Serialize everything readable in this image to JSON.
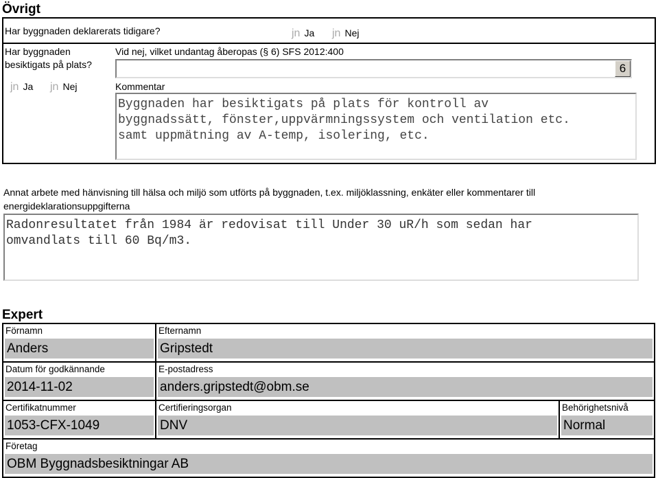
{
  "ovrigt": {
    "title": "Övrigt",
    "declared_question": "Har byggnaden deklarerats tidigare?",
    "radio_glyph": "jn",
    "yes": "Ja",
    "no": "Nej",
    "inspected_question_line1": "Har byggnaden",
    "inspected_question_line2": "besiktigats på plats?",
    "exception_label": "Vid nej, vilket undantag åberopas (§ 6) SFS 2012:400",
    "exception_value": "",
    "dropdown_glyph": "6",
    "comment_label": "Kommentar",
    "comment_value": "Byggnaden har besiktigats på plats för kontroll av\nbyggnadssätt, fönster,uppvärmningssystem och ventilation etc.\nsamt uppmätning av A-temp, isolering, etc."
  },
  "other_work": {
    "label_line1": "Annat arbete med hänvisning till hälsa och miljö som utförts på byggnaden, t.ex. miljöklassning, enkäter eller kommentarer till",
    "label_line2": "energideklarationsuppgifterna",
    "value": "Radonresultatet från 1984 är redovisat till Under 30 uR/h som sedan har\nomvandlats till 60 Bq/m3."
  },
  "expert": {
    "title": "Expert",
    "first_name_label": "Förnamn",
    "first_name": "Anders",
    "last_name_label": "Efternamn",
    "last_name": "Gripstedt",
    "date_label": "Datum för godkännande",
    "date": "2014-11-02",
    "email_label": "E-postadress",
    "email": "anders.gripstedt@obm.se",
    "cert_label": "Certifikatnummer",
    "cert": "1053-CFX-1049",
    "org_label": "Certifieringsorgan",
    "org": "DNV",
    "level_label": "Behörighetsnivå",
    "level": "Normal",
    "company_label": "Företag",
    "company": "OBM Byggnadsbesiktningar AB"
  }
}
